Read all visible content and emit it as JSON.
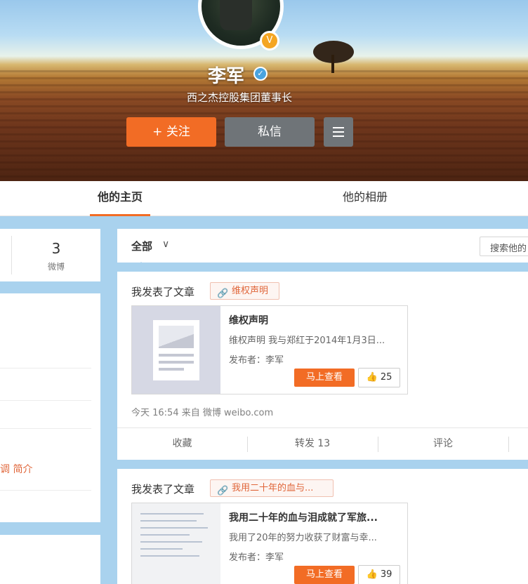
{
  "profile": {
    "name": "李军",
    "bio": "西之杰控股集团董事长",
    "follow_label": "+ 关注",
    "message_label": "私信",
    "more_icon": "menu-icon"
  },
  "tabs": [
    {
      "label": "他的主页",
      "active": true
    },
    {
      "label": "他的相册",
      "active": false
    }
  ],
  "stats": {
    "value": "3",
    "label": "微博"
  },
  "sidebar": {
    "link_text": "调 简介"
  },
  "filter": {
    "label": "全部",
    "search_placeholder": "搜索他的"
  },
  "posts": [
    {
      "action_text": "我发表了文章",
      "tag": "维权声明",
      "article": {
        "title": "维权声明",
        "desc": "维权声明 我与郑红于2014年1月3日...",
        "author": "发布者：李军",
        "view_label": "马上查看",
        "likes": "25"
      },
      "meta": "今天 16:54 来自 微博 weibo.com",
      "actions": {
        "collect": "收藏",
        "repost": "转发 13",
        "comment": "评论"
      }
    },
    {
      "action_text": "我发表了文章",
      "tag": "我用二十年的血与...",
      "article": {
        "title": "我用二十年的血与泪成就了军旅...",
        "desc": "我用了20年的努力收获了财富与幸...",
        "author": "发布者：李军",
        "view_label": "马上查看",
        "likes": "39"
      }
    }
  ],
  "colors": {
    "accent": "#f26c25",
    "dark_button": "#6f7478",
    "page_bg": "#a9d2ee"
  }
}
